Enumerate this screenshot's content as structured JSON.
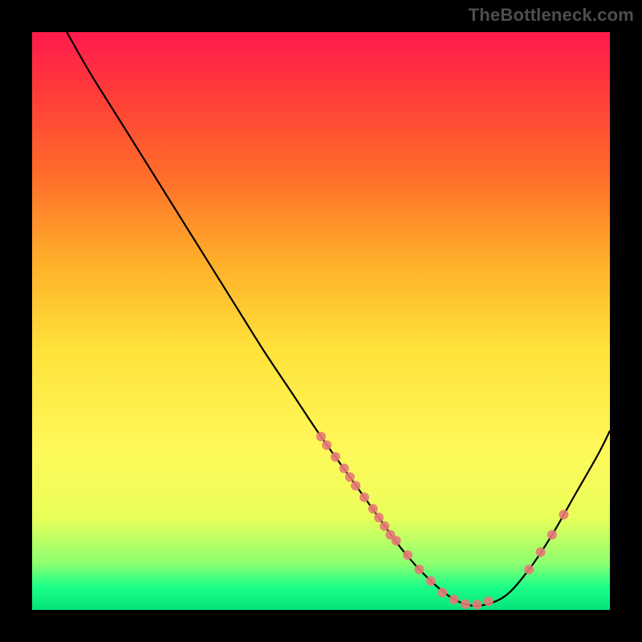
{
  "watermark": "TheBottleneck.com",
  "colors": {
    "curve": "#000000",
    "dot": "#e77a76",
    "dotAlpha": 0.9
  },
  "chart_data": {
    "type": "line",
    "title": "",
    "xlabel": "",
    "ylabel": "",
    "xlim": [
      0,
      100
    ],
    "ylim": [
      0,
      100
    ],
    "grid": false,
    "legend": false,
    "series": [
      {
        "name": "bottleneck-curve",
        "x": [
          6,
          10,
          15,
          20,
          25,
          30,
          35,
          40,
          45,
          50,
          55,
          60,
          64,
          68,
          72,
          75,
          78,
          82,
          86,
          90,
          94,
          98,
          100
        ],
        "y": [
          100,
          93,
          85,
          77,
          69,
          61,
          53,
          45,
          37.5,
          30,
          23,
          16,
          10.5,
          6,
          2.5,
          1,
          0.8,
          2.5,
          7,
          13,
          20,
          27,
          31
        ]
      }
    ],
    "dots": {
      "name": "sample-points",
      "x": [
        50,
        51,
        52.5,
        54,
        55,
        56,
        57.5,
        59,
        60,
        61,
        62,
        63,
        65,
        67,
        69,
        71,
        73,
        75,
        77,
        79,
        86,
        88,
        90,
        92
      ],
      "y": [
        30,
        28.5,
        26.5,
        24.5,
        23,
        21.5,
        19.5,
        17.5,
        16,
        14.5,
        13,
        12,
        9.5,
        7,
        5,
        3,
        1.8,
        1,
        0.9,
        1.5,
        7,
        10,
        13,
        16.5
      ],
      "r": 6
    }
  }
}
